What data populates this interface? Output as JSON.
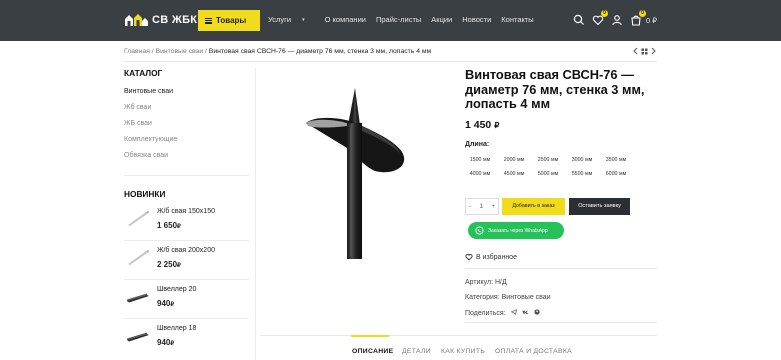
{
  "header": {
    "logo_text": "СВ ЖБК",
    "goods_button": "Товары",
    "nav": [
      {
        "label": "Услуги",
        "dropdown": true
      },
      {
        "label": "О компании"
      },
      {
        "label": "Прайс-листы"
      },
      {
        "label": "Акции"
      },
      {
        "label": "Новости"
      },
      {
        "label": "Контакты"
      }
    ],
    "favorites_count": "0",
    "cart_count": "0",
    "cart_total": "0 ₽"
  },
  "breadcrumb": {
    "home": "Главная",
    "sep": "/",
    "category": "Винтовые сваи",
    "current": "Винтовая свая СВСН-76 — диаметр 76 мм, стенка 3 мм, лопасть 4 мм"
  },
  "sidebar": {
    "catalog_title": "КАТАЛОГ",
    "catalog": [
      "Винтовые сваи",
      "Жб сваи",
      "ЖБ сваи",
      "Комплектующие",
      "Обвязка сваи"
    ],
    "new_title": "НОВИНКИ",
    "new_items": [
      {
        "name": "Ж/б свая 150х150",
        "price": "1 650",
        "currency": "₽",
        "icon": "concrete-pile-icon"
      },
      {
        "name": "Ж/б свая 200х200",
        "price": "2 250",
        "currency": "₽",
        "icon": "concrete-pile-icon"
      },
      {
        "name": "Швеллер 20",
        "price": "940",
        "currency": "₽",
        "icon": "channel-beam-icon"
      },
      {
        "name": "Швеллер 18",
        "price": "940",
        "currency": "₽",
        "icon": "channel-beam-icon"
      }
    ]
  },
  "product": {
    "title": "Винтовая свая СВСН-76 — диаметр 76 мм, стенка 3 мм, лопасть 4 мм",
    "price": "1 450",
    "currency": "₽",
    "length_label": "Длина:",
    "lengths": [
      "1500 мм",
      "2000 мм",
      "2500 мм",
      "3000 мм",
      "3500 мм",
      "4000 мм",
      "4500 мм",
      "5000 мм",
      "5500 мм",
      "6000 мм"
    ],
    "qty_minus": "-",
    "qty_value": "1",
    "qty_plus": "+",
    "order_button": "Добавить в заказ",
    "request_button": "Оставить заявку",
    "whatsapp_button": "Заказать через WhatsApp",
    "favorite_label": "В избранное",
    "sku": "Артикул: Н/Д",
    "category": "Категория: Винтовые сваи",
    "share_label": "Поделиться:",
    "share_icons": [
      "telegram-icon",
      "vk-icon",
      "odnoklassniki-icon"
    ]
  },
  "tabs": [
    "ОПИСАНИЕ",
    "ДЕТАЛИ",
    "КАК КУПИТЬ",
    "ОПЛАТА И ДОСТАВКА"
  ],
  "colors": {
    "header_bg": "#3a3f44",
    "accent": "#f0dc1b",
    "dark_button": "#2b2f33",
    "whatsapp": "#25c25a"
  }
}
